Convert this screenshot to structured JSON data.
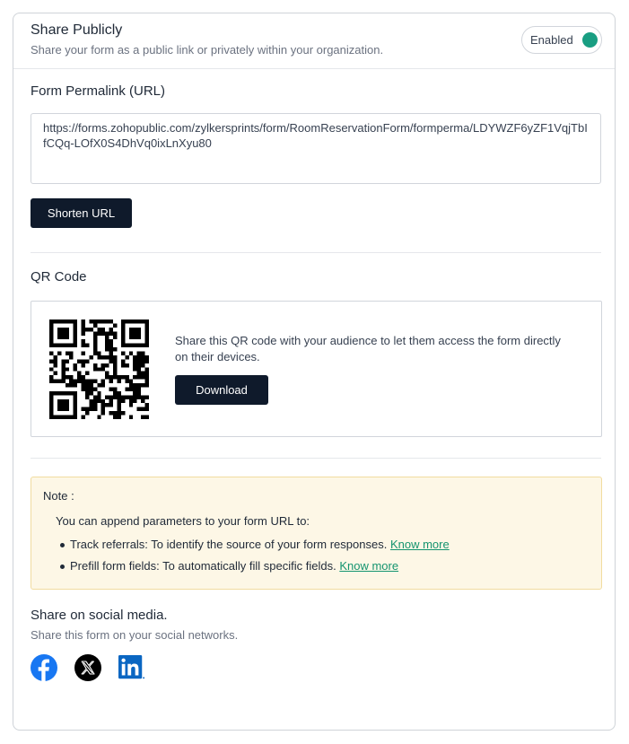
{
  "header": {
    "title": "Share Publicly",
    "subtitle": "Share your form as a public link or privately within your organization.",
    "toggle_label": "Enabled",
    "toggle_on": true,
    "accent_color": "#199e82"
  },
  "permalink": {
    "title": "Form Permalink (URL)",
    "url": "https://forms.zohopublic.com/zylkersprints/form/RoomReservationForm/formperma/LDYWZF6yZF1VqjTbIfCQq-LOfX0S4DhVq0ixLnXyu80",
    "shorten_label": "Shorten URL"
  },
  "qr": {
    "title": "QR Code",
    "description": "Share this QR code with your audience to let them access the form directly on their devices.",
    "download_label": "Download"
  },
  "note": {
    "title": "Note :",
    "intro": "You can append parameters to your form URL to:",
    "items": [
      {
        "text": "Track referrals: To identify the source of your form responses.",
        "link": "Know more"
      },
      {
        "text": "Prefill form fields: To automatically fill specific fields.",
        "link": "Know more"
      }
    ]
  },
  "social": {
    "title": "Share on social media.",
    "subtitle": "Share this form on your social networks.",
    "networks": [
      {
        "name": "facebook-icon",
        "color": "#1877f2"
      },
      {
        "name": "x-icon",
        "color": "#000000"
      },
      {
        "name": "linkedin-icon",
        "color": "#0a66c2"
      }
    ]
  }
}
